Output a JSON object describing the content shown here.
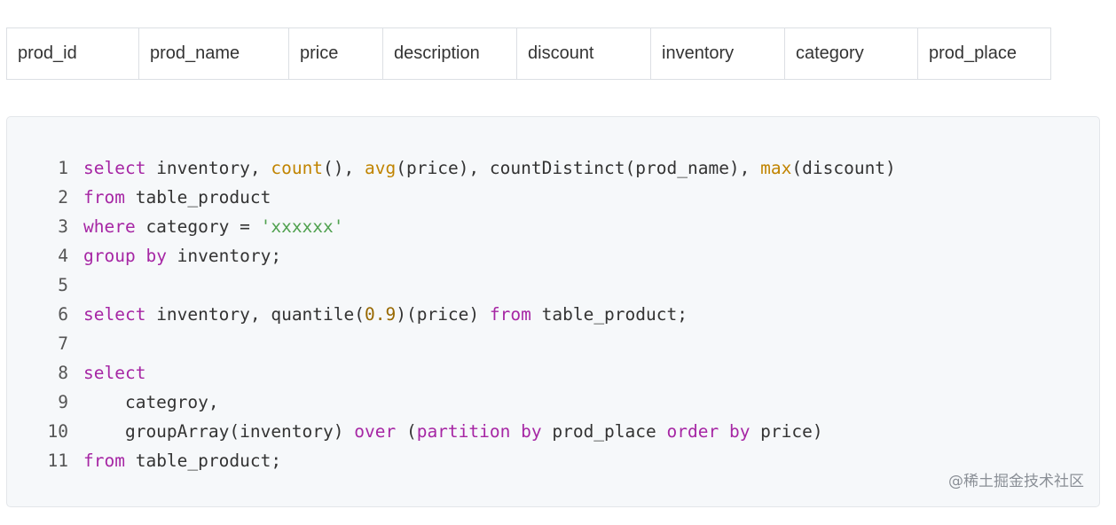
{
  "table": {
    "headers": [
      "prod_id",
      "prod_name",
      "price",
      "description",
      "discount",
      "inventory",
      "category",
      "prod_place"
    ]
  },
  "code": {
    "lines": [
      {
        "num": "1",
        "tokens": [
          {
            "t": "kw",
            "v": "select"
          },
          {
            "t": "p",
            "v": " inventory, "
          },
          {
            "t": "fn",
            "v": "count"
          },
          {
            "t": "p",
            "v": "(), "
          },
          {
            "t": "fn",
            "v": "avg"
          },
          {
            "t": "p",
            "v": "(price), countDistinct(prod_name), "
          },
          {
            "t": "fn",
            "v": "max"
          },
          {
            "t": "p",
            "v": "(discount)"
          }
        ]
      },
      {
        "num": "2",
        "tokens": [
          {
            "t": "kw",
            "v": "from"
          },
          {
            "t": "p",
            "v": " table_product"
          }
        ]
      },
      {
        "num": "3",
        "tokens": [
          {
            "t": "kw",
            "v": "where"
          },
          {
            "t": "p",
            "v": " category = "
          },
          {
            "t": "str",
            "v": "'xxxxxx'"
          }
        ]
      },
      {
        "num": "4",
        "tokens": [
          {
            "t": "kw",
            "v": "group"
          },
          {
            "t": "p",
            "v": " "
          },
          {
            "t": "kw",
            "v": "by"
          },
          {
            "t": "p",
            "v": " inventory;"
          }
        ]
      },
      {
        "num": "5",
        "tokens": []
      },
      {
        "num": "6",
        "tokens": [
          {
            "t": "kw",
            "v": "select"
          },
          {
            "t": "p",
            "v": " inventory, quantile("
          },
          {
            "t": "num",
            "v": "0.9"
          },
          {
            "t": "p",
            "v": ")(price) "
          },
          {
            "t": "kw",
            "v": "from"
          },
          {
            "t": "p",
            "v": " table_product;"
          }
        ]
      },
      {
        "num": "7",
        "tokens": []
      },
      {
        "num": "8",
        "tokens": [
          {
            "t": "kw",
            "v": "select"
          }
        ]
      },
      {
        "num": "9",
        "tokens": [
          {
            "t": "p",
            "v": "    categroy,"
          }
        ]
      },
      {
        "num": "10",
        "tokens": [
          {
            "t": "p",
            "v": "    groupArray(inventory) "
          },
          {
            "t": "kw",
            "v": "over"
          },
          {
            "t": "p",
            "v": " ("
          },
          {
            "t": "kw",
            "v": "partition"
          },
          {
            "t": "p",
            "v": " "
          },
          {
            "t": "kw",
            "v": "by"
          },
          {
            "t": "p",
            "v": " prod_place "
          },
          {
            "t": "kw",
            "v": "order"
          },
          {
            "t": "p",
            "v": " "
          },
          {
            "t": "kw",
            "v": "by"
          },
          {
            "t": "p",
            "v": " price)"
          }
        ]
      },
      {
        "num": "11",
        "tokens": [
          {
            "t": "kw",
            "v": "from"
          },
          {
            "t": "p",
            "v": " table_product;"
          }
        ]
      }
    ]
  },
  "watermark": "@稀土掘金技术社区"
}
